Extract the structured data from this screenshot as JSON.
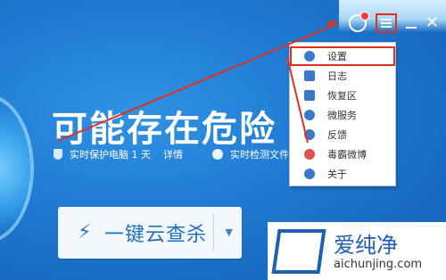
{
  "headline": "可能存在危险",
  "status": {
    "protection_text": "实时保护电脑 1 天",
    "detail_link": "详情",
    "detection_text": "实时检测文件"
  },
  "scan_button": {
    "label": "一键云查杀"
  },
  "menu": {
    "items": [
      {
        "label": "设置",
        "icon": "gear-icon"
      },
      {
        "label": "日志",
        "icon": "log-icon"
      },
      {
        "label": "恢复区",
        "icon": "restore-icon"
      },
      {
        "label": "微服务",
        "icon": "service-icon"
      },
      {
        "label": "反馈",
        "icon": "feedback-icon"
      },
      {
        "label": "毒霸微博",
        "icon": "weibo-icon"
      },
      {
        "label": "关于",
        "icon": "info-icon"
      }
    ]
  },
  "watermark": {
    "title": "爱纯净",
    "url": "aichunjing.com"
  },
  "colors": {
    "accent": "#1f79d2",
    "annotation": "#e0301e",
    "button_text": "#1f6fc2"
  }
}
